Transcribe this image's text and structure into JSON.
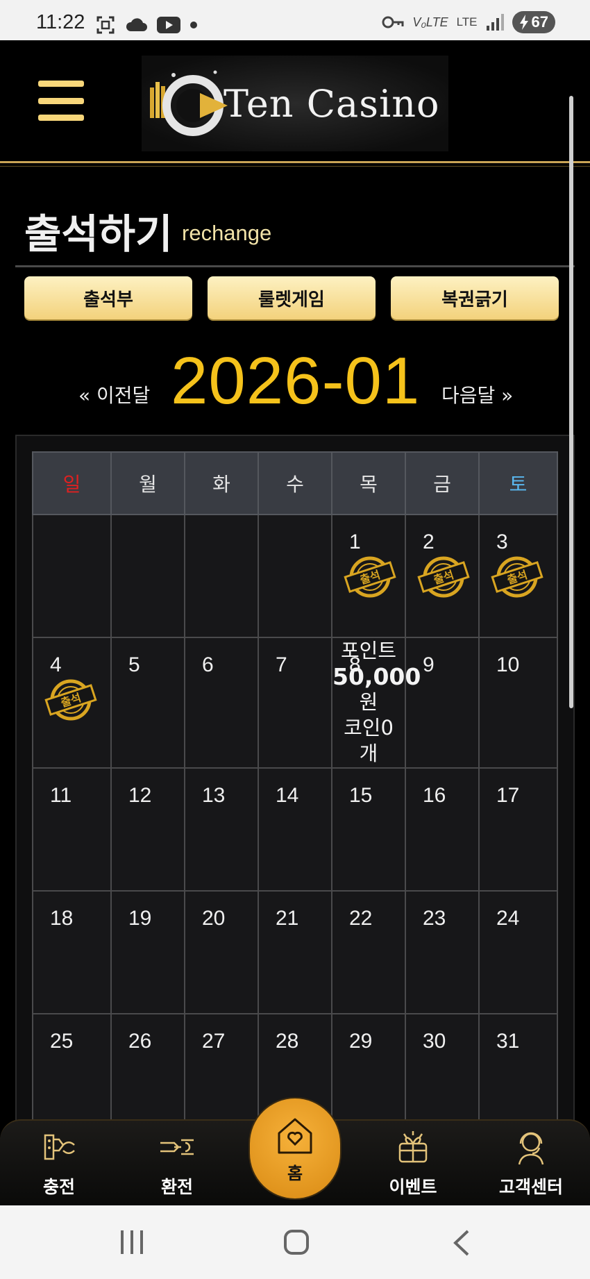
{
  "status_bar": {
    "time": "11:22",
    "network_label": "LTE",
    "battery_level": "67"
  },
  "header": {
    "logo_text": "Ten Casino"
  },
  "page": {
    "title": "출석하기",
    "subtitle": "rechange"
  },
  "tabs": [
    {
      "label": "출석부"
    },
    {
      "label": "룰렛게임"
    },
    {
      "label": "복권긁기"
    }
  ],
  "month_nav": {
    "prev_label": "« 이전달",
    "current_month": "2026-01",
    "next_label": "다음달 »"
  },
  "calendar": {
    "weekday_headers": [
      "일",
      "월",
      "화",
      "수",
      "목",
      "금",
      "토"
    ],
    "colors": {
      "sunday": "#e02020",
      "saturday": "#5ab8f0",
      "stamp": "#d9a521"
    },
    "stamp_label": "출석",
    "attended_days": [
      1,
      2,
      3,
      4
    ],
    "today_info": {
      "day": "8",
      "line1": "포인트",
      "line2": "50,000",
      "line3": "원",
      "line4": "코인0",
      "line5": "개"
    }
  },
  "bottom_nav": [
    {
      "label": "충전",
      "icon": "charge-icon"
    },
    {
      "label": "환전",
      "icon": "exchange-icon"
    },
    {
      "label": "홈",
      "icon": "home-heart-icon"
    },
    {
      "label": "이벤트",
      "icon": "gift-icon"
    },
    {
      "label": "고객센터",
      "icon": "support-icon"
    }
  ]
}
